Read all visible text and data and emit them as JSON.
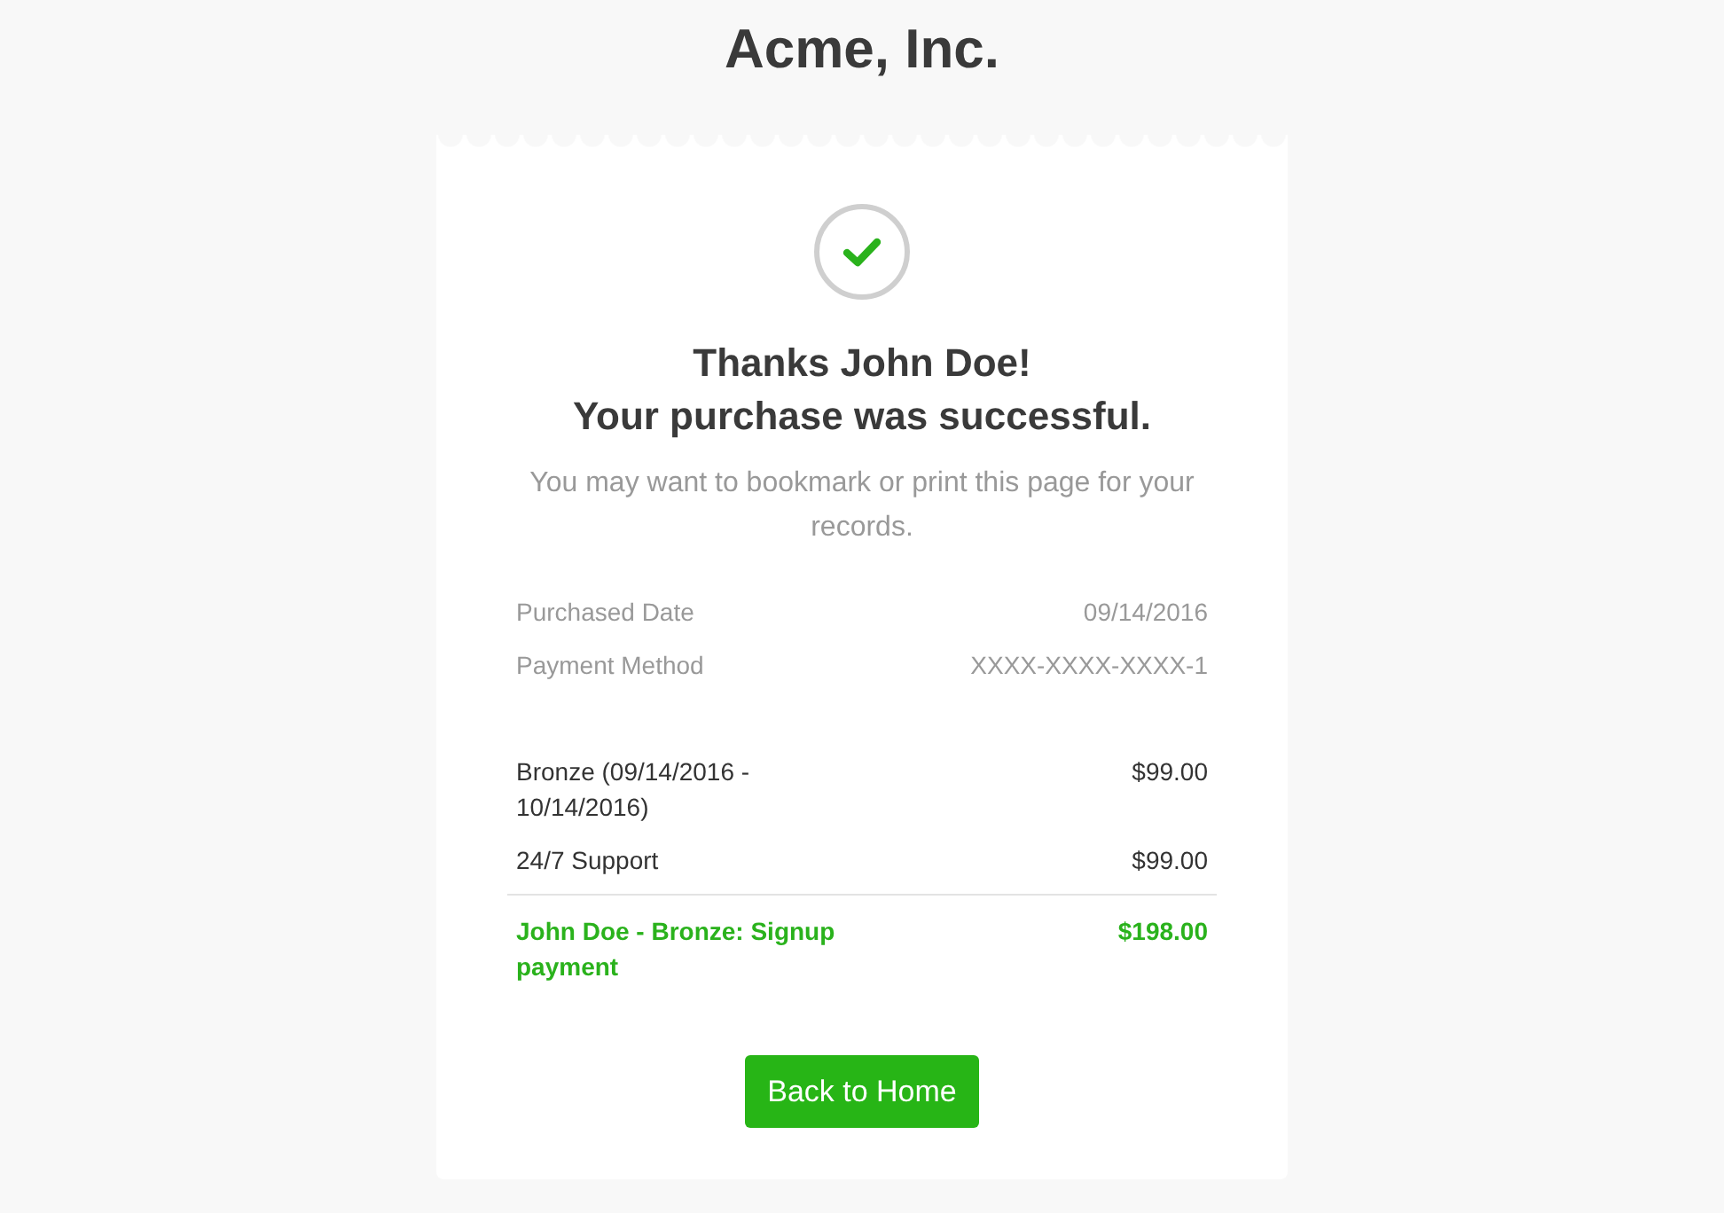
{
  "header": {
    "title": "Acme, Inc."
  },
  "receipt": {
    "heading": "Thanks John Doe!",
    "subheading": "Your purchase was successful.",
    "note": "You may want to bookmark or print this page for your records.",
    "details": [
      {
        "label": "Purchased Date",
        "value": "09/14/2016"
      },
      {
        "label": "Payment Method",
        "value": "XXXX-XXXX-XXXX-1"
      }
    ],
    "items": [
      {
        "description": "Bronze (09/14/2016 - 10/14/2016)",
        "amount": "$99.00"
      },
      {
        "description": "24/7 Support",
        "amount": "$99.00"
      }
    ],
    "total": {
      "description": "John Doe - Bronze: Signup payment",
      "amount": "$198.00"
    },
    "button": {
      "label": "Back to Home"
    }
  }
}
